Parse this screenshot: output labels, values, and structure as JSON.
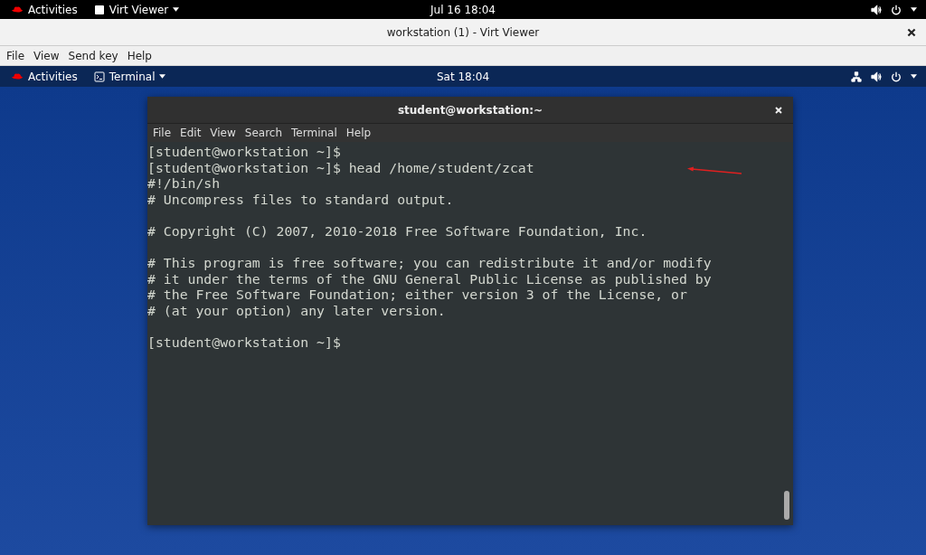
{
  "host_top_bar": {
    "activities": "Activities",
    "app_menu": "Virt Viewer",
    "clock": "Jul 16  18:04"
  },
  "viewer_window": {
    "title": "workstation (1) - Virt Viewer",
    "menu": [
      "File",
      "View",
      "Send key",
      "Help"
    ]
  },
  "guest_top_bar": {
    "activities": "Activities",
    "app_menu": "Terminal",
    "clock": "Sat 18:04"
  },
  "terminal": {
    "title": "student@workstation:~",
    "menu": [
      "File",
      "Edit",
      "View",
      "Search",
      "Terminal",
      "Help"
    ],
    "paragraphs": [
      {
        "lines": [
          "[student@workstation ~]$",
          "[student@workstation ~]$ head /home/student/zcat",
          "#!/bin/sh",
          "# Uncompress files to standard output."
        ]
      },
      {
        "lines": [
          "# Copyright (C) 2007, 2010-2018 Free Software Foundation, Inc."
        ]
      },
      {
        "lines": [
          "# This program is free software; you can redistribute it and/or modify",
          "# it under the terms of the GNU General Public License as published by",
          "# the Free Software Foundation; either version 3 of the License, or",
          "# (at your option) any later version."
        ]
      },
      {
        "lines": [
          "[student@workstation ~]$"
        ]
      }
    ]
  }
}
